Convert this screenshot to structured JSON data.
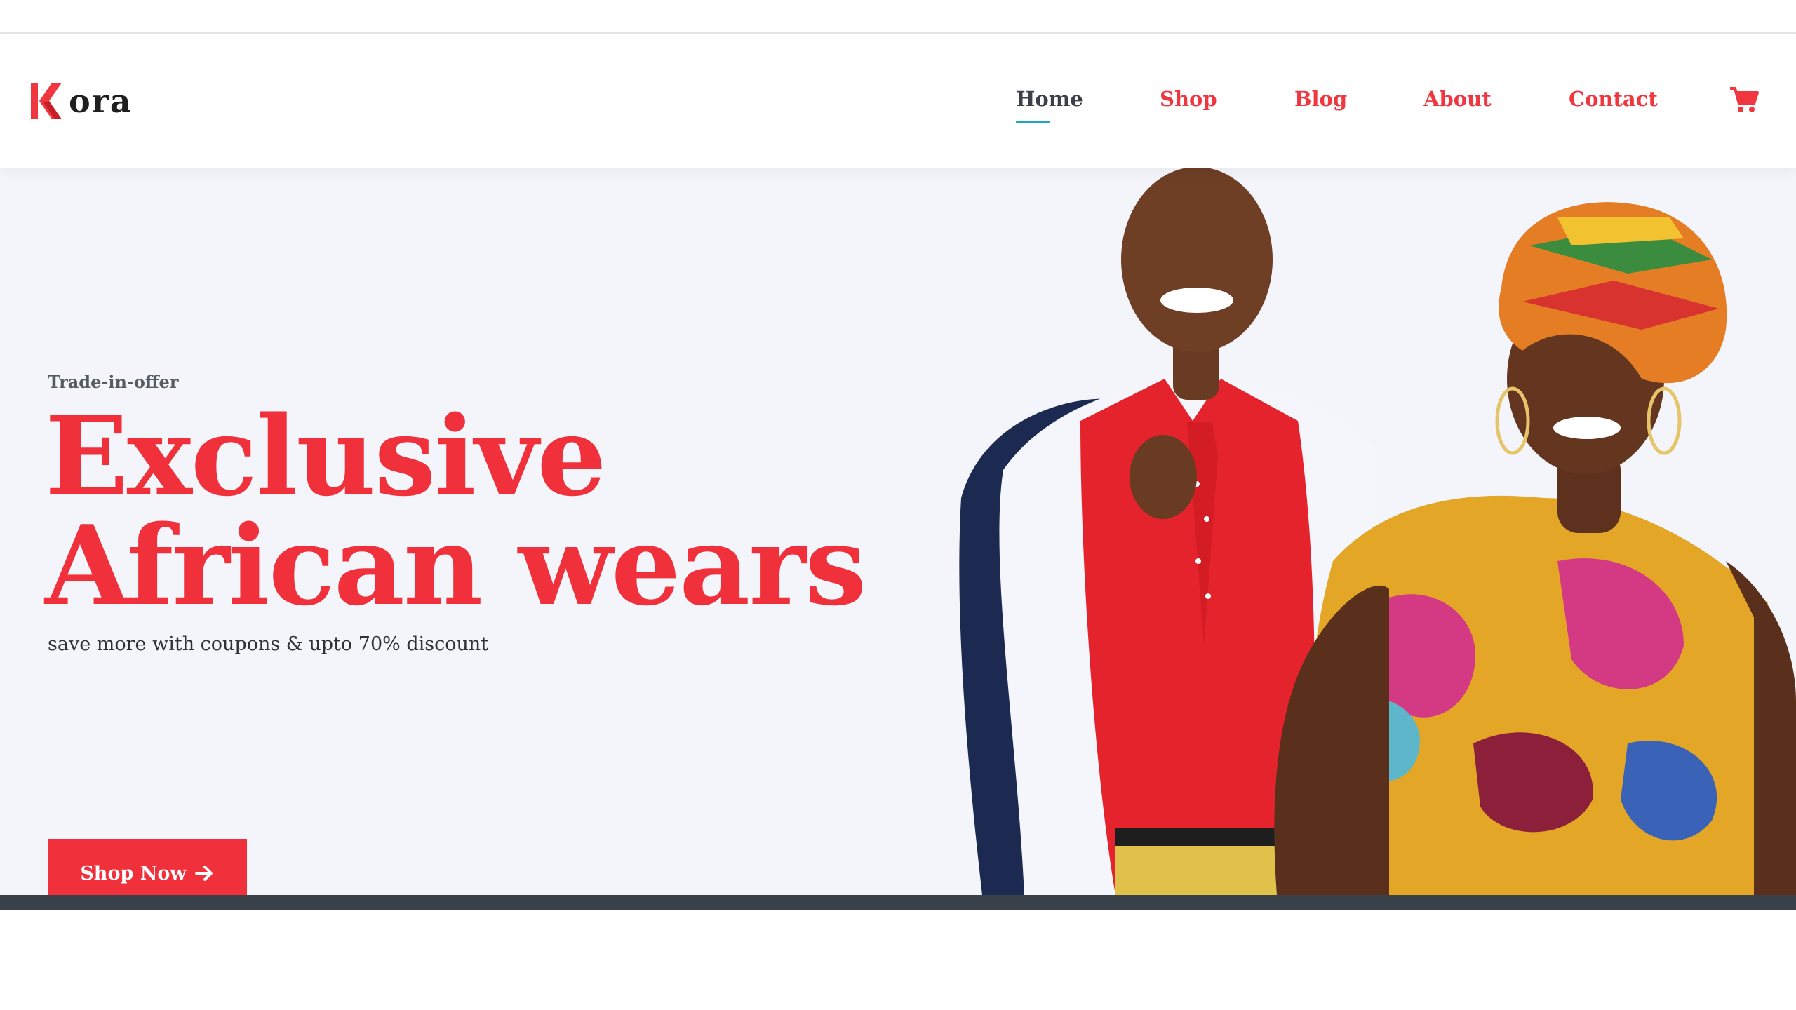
{
  "brand": {
    "name": "ora",
    "accent_color": "#f0363e",
    "logo_icon": "k-logo-icon"
  },
  "nav": {
    "items": [
      {
        "label": "Home",
        "active": true
      },
      {
        "label": "Shop",
        "active": false
      },
      {
        "label": "Blog",
        "active": false
      },
      {
        "label": "About",
        "active": false
      },
      {
        "label": "Contact",
        "active": false
      }
    ],
    "cart_icon": "shopping-cart-icon",
    "active_underline_color": "#1fa3c9"
  },
  "hero": {
    "eyebrow": "Trade-in-offer",
    "headline_line1": "Exclusive",
    "headline_line2": "African wears",
    "subline": "save more with coupons & upto 70% discount",
    "cta_label": "Shop Now",
    "cta_icon": "arrow-right-icon",
    "background_color": "#f4f5fa"
  }
}
